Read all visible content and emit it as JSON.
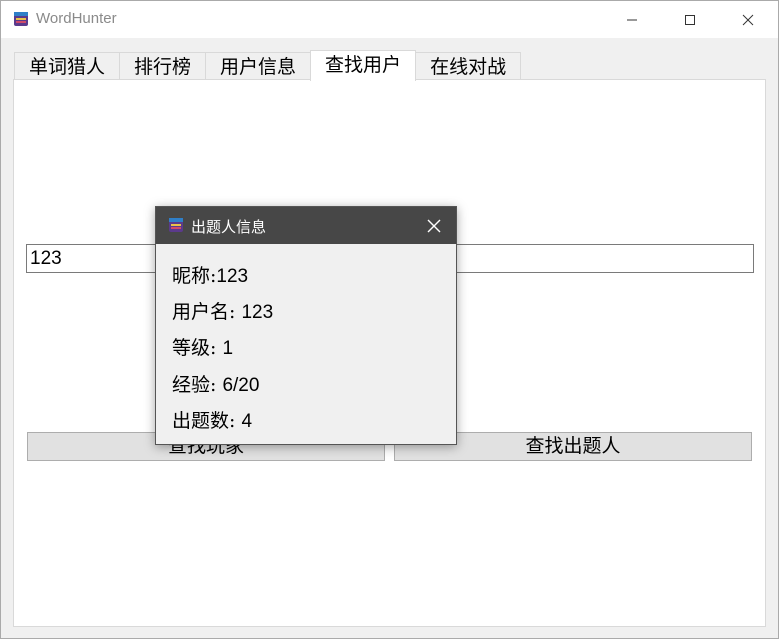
{
  "window": {
    "title": "WordHunter"
  },
  "tabs": [
    {
      "label": "单词猎人",
      "active": false
    },
    {
      "label": "排行榜",
      "active": false
    },
    {
      "label": "用户信息",
      "active": false
    },
    {
      "label": "查找用户",
      "active": true
    },
    {
      "label": "在线对战",
      "active": false
    }
  ],
  "search": {
    "value": "123"
  },
  "buttons": {
    "find_player": "查找玩家",
    "find_setter": "查找出题人"
  },
  "dialog": {
    "title": "出题人信息",
    "lines": [
      {
        "label": "昵称:",
        "value": "123"
      },
      {
        "label": "用户名: ",
        "value": "123"
      },
      {
        "label": "等级: ",
        "value": "1"
      },
      {
        "label": "经验: ",
        "value": "6/20"
      },
      {
        "label": "出题数: ",
        "value": "4"
      }
    ]
  },
  "colors": {
    "dialog_titlebar": "#474747",
    "window_title_text": "#8a8a8a",
    "button_bg": "#e1e1e1"
  }
}
